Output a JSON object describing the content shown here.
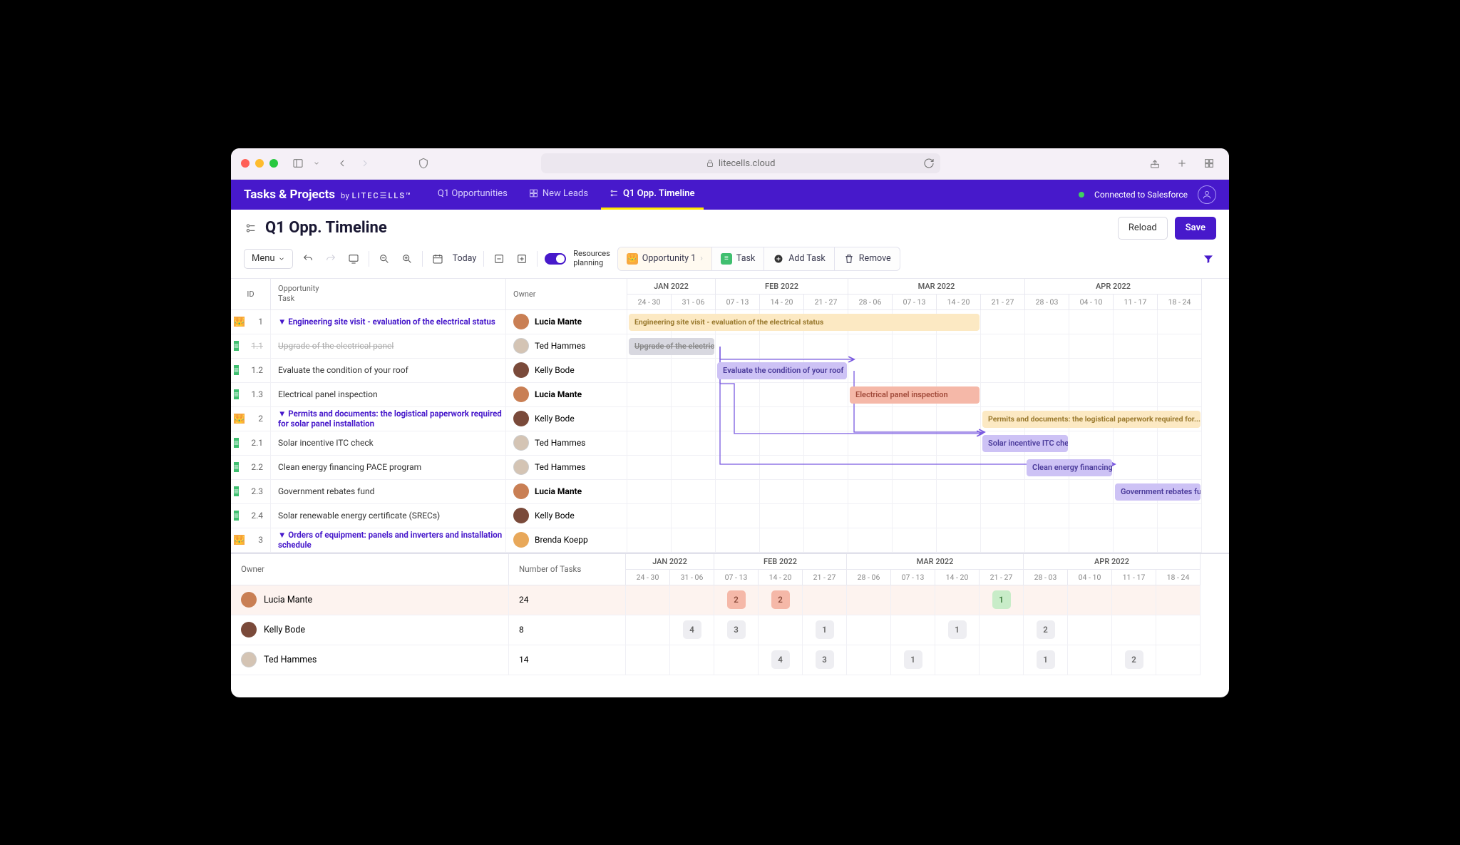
{
  "chrome": {
    "url": "litecells.cloud"
  },
  "header": {
    "brand": "Tasks & Projects",
    "by": "by",
    "brand2": "LITEC☰LLS™",
    "tabs": [
      {
        "label": "Q1 Opportunities"
      },
      {
        "label": "New Leads"
      },
      {
        "label": "Q1 Opp. Timeline"
      }
    ],
    "connected": "Connected to Salesforce"
  },
  "title": {
    "text": "Q1 Opp. Timeline",
    "reload": "Reload",
    "save": "Save"
  },
  "toolbar": {
    "menu": "Menu",
    "today": "Today",
    "switch_l1": "Resources",
    "switch_l2": "planning",
    "crumb": {
      "opp": "Opportunity 1",
      "task": "Task",
      "add": "Add Task",
      "remove": "Remove"
    }
  },
  "cols": {
    "id": "ID",
    "opp": "Opportunity",
    "task": "Task",
    "owner": "Owner",
    "months": [
      "JAN 2022",
      "FEB 2022",
      "MAR 2022",
      "APR 2022"
    ],
    "weeks": [
      "24 - 30",
      "31 - 06",
      "07 - 13",
      "14 - 20",
      "21 - 27",
      "28 - 06",
      "07 - 13",
      "14 - 20",
      "21 - 27",
      "28 - 03",
      "04 - 10",
      "11 - 17",
      "18 - 24"
    ]
  },
  "rows": [
    {
      "kind": "opp",
      "id": "1",
      "title": "▼ Engineering site visit - evaluation of the electrical status",
      "owner": "Lucia Mante",
      "av": "a1",
      "bold": true,
      "bar": {
        "cls": "yel",
        "start": 0,
        "span": 8,
        "text": "Engineering site visit - evaluation of the electrical status"
      }
    },
    {
      "kind": "task",
      "id": "1.1",
      "done": true,
      "title": "Upgrade of the electrical panel",
      "owner": "Ted Hammes",
      "av": "a3",
      "bar": {
        "cls": "gry",
        "start": 0,
        "span": 2,
        "text": "Upgrade of the electrical"
      }
    },
    {
      "kind": "task",
      "id": "1.2",
      "title": "Evaluate the condition of your roof",
      "owner": "Kelly Bode",
      "av": "a2",
      "bar": {
        "cls": "pur",
        "start": 2,
        "span": 3,
        "text": "Evaluate the condition of your roof"
      }
    },
    {
      "kind": "task",
      "id": "1.3",
      "title": "Electrical panel inspection",
      "owner": "Lucia Mante",
      "av": "a1",
      "bold": true,
      "bar": {
        "cls": "ora",
        "start": 5,
        "span": 3,
        "text": "Electrical panel inspection"
      }
    },
    {
      "kind": "opp",
      "id": "2",
      "title": "▼ Permits and documents: the logistical paperwork required for solar panel installation",
      "owner": "Kelly Bode",
      "av": "a2",
      "bar": {
        "cls": "yel",
        "start": 8,
        "span": 5,
        "text": "Permits and documents: the logistical paperwork required for..."
      }
    },
    {
      "kind": "task",
      "id": "2.1",
      "title": "Solar incentive ITC check",
      "owner": "Ted Hammes",
      "av": "a3",
      "bar": {
        "cls": "pur",
        "start": 8,
        "span": 2,
        "text": "Solar incentive ITC check"
      }
    },
    {
      "kind": "task",
      "id": "2.2",
      "title": "Clean energy financing PACE program",
      "owner": "Ted Hammes",
      "av": "a3",
      "bar": {
        "cls": "pur",
        "start": 9,
        "span": 2,
        "text": "Clean energy financing PA..."
      }
    },
    {
      "kind": "task",
      "id": "2.3",
      "title": "Government rebates fund",
      "owner": "Lucia Mante",
      "av": "a1",
      "bold": true,
      "bar": {
        "cls": "pur",
        "start": 11,
        "span": 2,
        "text": "Government rebates fund"
      }
    },
    {
      "kind": "task",
      "id": "2.4",
      "title": "Solar renewable energy certificate (SRECs)",
      "owner": "Kelly Bode",
      "av": "a2"
    },
    {
      "kind": "opp",
      "id": "3",
      "title": "▼ Orders of equipment: panels and inverters and installation schedule",
      "owner": "Brenda Koepp",
      "av": "a4"
    }
  ],
  "res": {
    "owner": "Owner",
    "ntasks": "Number of Tasks",
    "rows": [
      {
        "name": "Lucia Mante",
        "av": "a1",
        "n": "24",
        "hl": true,
        "cells": {
          "2": {
            "v": "2",
            "c": "o"
          },
          "3": {
            "v": "2",
            "c": "o"
          },
          "8": {
            "v": "1",
            "c": "g"
          }
        }
      },
      {
        "name": "Kelly Bode",
        "av": "a2",
        "n": "8",
        "cells": {
          "1": {
            "v": "4",
            "c": "n"
          },
          "2": {
            "v": "3",
            "c": "n"
          },
          "4": {
            "v": "1",
            "c": "n"
          },
          "7": {
            "v": "1",
            "c": "n"
          },
          "9": {
            "v": "2",
            "c": "n"
          }
        }
      },
      {
        "name": "Ted Hammes",
        "av": "a3",
        "n": "14",
        "cells": {
          "3": {
            "v": "4",
            "c": "n"
          },
          "4": {
            "v": "3",
            "c": "n"
          },
          "6": {
            "v": "1",
            "c": "n"
          },
          "9": {
            "v": "1",
            "c": "n"
          },
          "11": {
            "v": "2",
            "c": "n"
          }
        }
      }
    ]
  }
}
